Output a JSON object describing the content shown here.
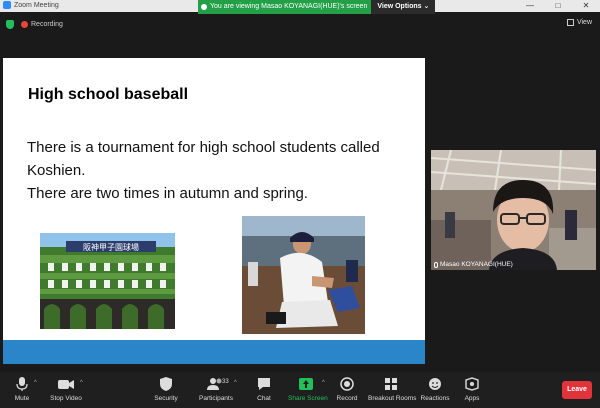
{
  "window": {
    "title": "Zoom Meeting",
    "controls": [
      "—",
      "□",
      "✕"
    ]
  },
  "share_banner": {
    "viewing_text": "You are viewing Masao KOYANAGI(HUE)'s screen",
    "view_options": "View Options ⌄"
  },
  "top_bar": {
    "recording_label": "Recording",
    "view_label": "View"
  },
  "slide": {
    "title": "High school baseball",
    "lines": [
      "There is a tournament  for high school students called",
      "Koshien.",
      "There are two times in autumn and spring."
    ],
    "stadium_sign": "阪神甲子園球場"
  },
  "participant": {
    "name": "Masao KOYANAGI(HUE)"
  },
  "toolbar": {
    "mute": "Mute",
    "stop_video": "Stop Video",
    "security": "Security",
    "participants": "Participants",
    "participants_count": "33",
    "chat": "Chat",
    "share_screen": "Share Screen",
    "record": "Record",
    "breakout_rooms": "Breakout Rooms",
    "reactions": "Reactions",
    "apps": "Apps",
    "leave": "Leave"
  },
  "colors": {
    "share_green": "#23a047",
    "leave_red": "#e0343a",
    "slide_bar_blue": "#2a86c9"
  }
}
